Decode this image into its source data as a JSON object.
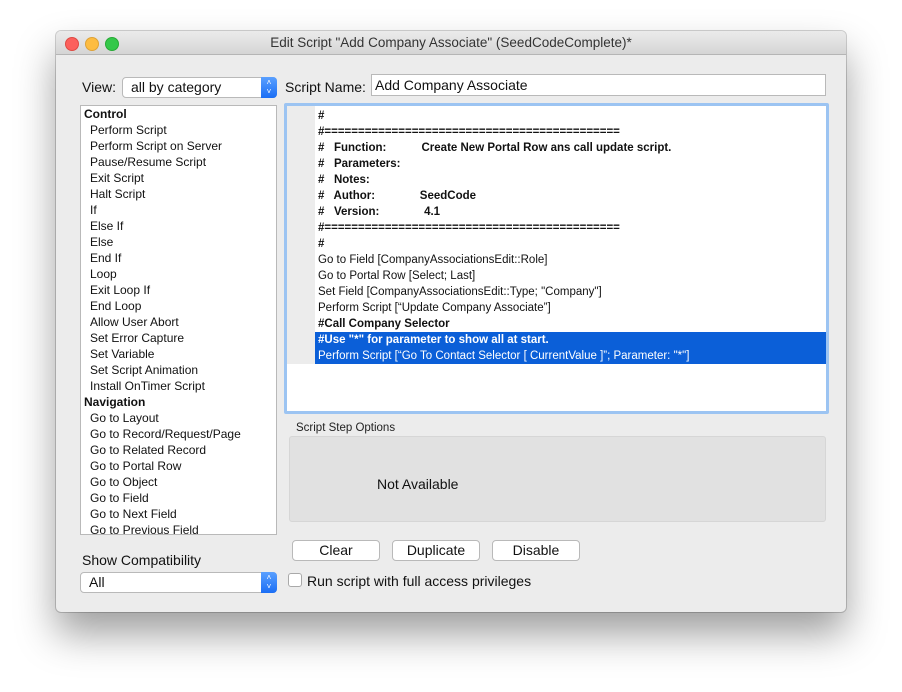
{
  "window": {
    "title": "Edit Script \"Add Company Associate\" (SeedCodeComplete)*"
  },
  "view": {
    "label": "View:",
    "selected": "all by category"
  },
  "script_name": {
    "label": "Script Name:",
    "value": "Add Company Associate"
  },
  "steps": [
    {
      "label": "Control",
      "category": true
    },
    {
      "label": "Perform Script"
    },
    {
      "label": "Perform Script on Server"
    },
    {
      "label": "Pause/Resume Script"
    },
    {
      "label": "Exit Script"
    },
    {
      "label": "Halt Script"
    },
    {
      "label": "If"
    },
    {
      "label": "Else If"
    },
    {
      "label": "Else"
    },
    {
      "label": "End If"
    },
    {
      "label": "Loop"
    },
    {
      "label": "Exit Loop If"
    },
    {
      "label": "End Loop"
    },
    {
      "label": "Allow User Abort"
    },
    {
      "label": "Set Error Capture"
    },
    {
      "label": "Set Variable"
    },
    {
      "label": "Set Script Animation"
    },
    {
      "label": "Install OnTimer Script"
    },
    {
      "label": "Navigation",
      "category": true
    },
    {
      "label": "Go to Layout"
    },
    {
      "label": "Go to Record/Request/Page"
    },
    {
      "label": "Go to Related Record"
    },
    {
      "label": "Go to Portal Row"
    },
    {
      "label": "Go to Object"
    },
    {
      "label": "Go to Field"
    },
    {
      "label": "Go to Next Field"
    },
    {
      "label": "Go to Previous Field"
    }
  ],
  "script_lines": [
    {
      "text": "#",
      "bold": true
    },
    {
      "text": "#============================================",
      "bold": true
    },
    {
      "text": "#   Function:           Create New Portal Row ans call update script.",
      "bold": true
    },
    {
      "text": "#   Parameters:",
      "bold": true
    },
    {
      "text": "#   Notes:",
      "bold": true
    },
    {
      "text": "#   Author:              SeedCode",
      "bold": true
    },
    {
      "text": "#   Version:              4.1",
      "bold": true
    },
    {
      "text": "#============================================",
      "bold": true
    },
    {
      "text": "#",
      "bold": true
    },
    {
      "text": "Go to Field [CompanyAssociationsEdit::Role]"
    },
    {
      "text": "Go to Portal Row [Select; Last]"
    },
    {
      "text": "Set Field [CompanyAssociationsEdit::Type; \"Company\"]"
    },
    {
      "text": "Perform Script [“Update Company Associate”]"
    },
    {
      "text": "#Call Company Selector",
      "bold": true
    },
    {
      "text": "#Use \"*\" for parameter to show all at start.",
      "bold": true,
      "selected": true
    },
    {
      "text": "Perform Script [“Go To Contact Selector [ CurrentValue ]”; Parameter: \"*\"]",
      "selected": true
    }
  ],
  "options": {
    "label": "Script Step Options",
    "status": "Not Available"
  },
  "buttons": {
    "clear": "Clear",
    "duplicate": "Duplicate",
    "disable": "Disable"
  },
  "full_access": {
    "label": "Run script with full access privileges",
    "checked": false
  },
  "compatibility": {
    "label": "Show Compatibility",
    "selected": "All"
  },
  "colors": {
    "selection": "#0b5fd8",
    "focus_ring": "#9cc4f2",
    "stepper": "#1a6ef5"
  }
}
